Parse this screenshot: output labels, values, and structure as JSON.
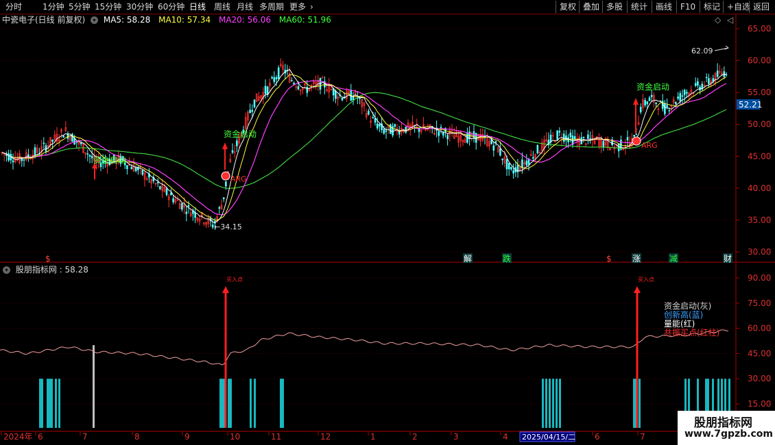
{
  "toolbar": {
    "periods": [
      "分时",
      "1分钟",
      "5分钟",
      "15分钟",
      "30分钟",
      "60分钟",
      "日线",
      "周线",
      "月线",
      "多周期",
      "更多"
    ],
    "active_period": "日线",
    "more_arrow": "›",
    "right": [
      "复权",
      "叠加",
      "多股",
      "统计",
      "画线",
      "F10",
      "标记",
      "+自选",
      "返回"
    ]
  },
  "main_header": {
    "title": "中瓷电子(日线 前复权)",
    "ma": [
      {
        "label": "MA5: 58.28",
        "color": "#ffffff"
      },
      {
        "label": "MA10: 57.34",
        "color": "#ffff40"
      },
      {
        "label": "MA20: 56.06",
        "color": "#ff40ff"
      },
      {
        "label": "MA60: 51.96",
        "color": "#40ff40"
      }
    ],
    "corner_icon": "◇",
    "corner_arrow": "◁"
  },
  "sub_header": {
    "title": "股朋指标网 : 58.28"
  },
  "colors": {
    "up": "#ff3232",
    "down": "#54ffff",
    "ma5": "#ffffff",
    "ma10": "#ffff40",
    "ma20": "#ff40ff",
    "ma60": "#40d040",
    "axis": "#b00000",
    "signal": "#ff2020",
    "indicator_line": "#f0a0a0",
    "bar_cyan": "#18b8c0",
    "bar_gray": "#c0c0c0"
  },
  "main_axis": {
    "ticks": [
      "65.00",
      "60.00",
      "55.00",
      "50.00",
      "45.00",
      "40.00",
      "35.00",
      "30.00"
    ]
  },
  "sub_axis": {
    "ticks": [
      "90.00",
      "75.00",
      "60.00",
      "45.00",
      "30.00",
      "15.00"
    ]
  },
  "price_labels": {
    "current": "52.21",
    "high": "62.09",
    "low": "←34.15"
  },
  "signals": {
    "capital_start": "资金启动",
    "arrow_tag": "ARG",
    "sub_arrow_tag": "买入点"
  },
  "event_markers": [
    {
      "text": "$",
      "color": "#ff4040"
    },
    {
      "text": "解",
      "color": "#ffffff"
    },
    {
      "text": "跌",
      "color": "#30ff30"
    },
    {
      "text": "$",
      "color": "#ff4040"
    },
    {
      "text": "涨",
      "color": "#ffffff"
    },
    {
      "text": "减",
      "color": "#30ff30"
    },
    {
      "text": "财",
      "color": "#ffffff"
    }
  ],
  "legend": [
    {
      "label": "资金启动(灰)",
      "color": "#d0d0d0"
    },
    {
      "label": "创新高(蓝)",
      "color": "#3ca0ff"
    },
    {
      "label": "量能(红)",
      "color": "#ffffff"
    },
    {
      "label": "共振买点(红柱)",
      "color": "#ff3030"
    }
  ],
  "xaxis": {
    "labels": [
      "2024年",
      "6",
      "7",
      "8",
      "9",
      "10",
      "11",
      "12",
      "1",
      "2",
      "3",
      "4",
      "5",
      "6",
      "7"
    ],
    "cursor_date": "2025/04/15/二"
  },
  "watermark": {
    "line1": "股朋指标网",
    "line2": "www.7gpzb.com"
  }
}
